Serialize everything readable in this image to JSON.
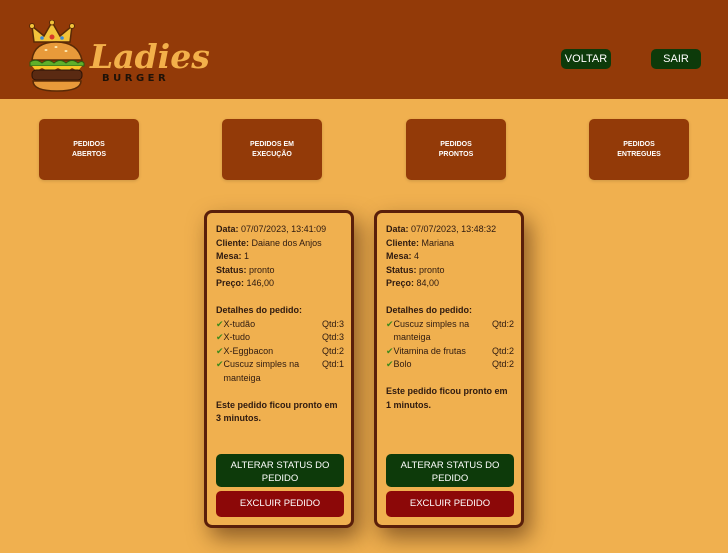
{
  "brand": {
    "name": "Ladies",
    "sub": "BURGER"
  },
  "header": {
    "voltar_label": "VOLTAR",
    "sair_label": "SAIR"
  },
  "nav": [
    {
      "label": "PEDIDOS ABERTOS"
    },
    {
      "label": "PEDIDOS EM EXECUÇÃO"
    },
    {
      "label": "PEDIDOS PRONTOS"
    },
    {
      "label": "PEDIDOS ENTREGUES"
    }
  ],
  "labels": {
    "data": "Data:",
    "cliente": "Cliente:",
    "mesa": "Mesa:",
    "status": "Status:",
    "preco": "Preço:",
    "detalhes": "Detalhes do pedido:",
    "alterar": "ALTERAR STATUS DO PEDIDO",
    "excluir": "EXCLUIR PEDIDO"
  },
  "orders": [
    {
      "data": "07/07/2023, 13:41:09",
      "cliente": "Daiane dos Anjos",
      "mesa": "1",
      "status": "pronto",
      "preco": "146,00",
      "items": [
        {
          "name": "X-tudão",
          "qty": "Qtd:3"
        },
        {
          "name": "X-tudo",
          "qty": "Qtd:3"
        },
        {
          "name": "X-Eggbacon",
          "qty": "Qtd:2"
        },
        {
          "name": "Cuscuz simples na manteiga",
          "qty": "Qtd:1"
        }
      ],
      "note": "Este pedido ficou pronto em 3 minutos."
    },
    {
      "data": "07/07/2023, 13:48:32",
      "cliente": "Mariana",
      "mesa": "4",
      "status": "pronto",
      "preco": "84,00",
      "items": [
        {
          "name": "Cuscuz simples na manteiga",
          "qty": "Qtd:2"
        },
        {
          "name": "Vitamina de frutas",
          "qty": "Qtd:2"
        },
        {
          "name": "Bolo",
          "qty": "Qtd:2"
        }
      ],
      "note": "Este pedido ficou pronto em 1 minutos."
    }
  ],
  "icons": {
    "check": "check-icon",
    "logo": "burger-crown-logo"
  },
  "colors": {
    "header": "#933a08",
    "background": "#f0b04f",
    "green": "#0d3a0a",
    "red": "#8c0808",
    "card_border": "#5a1f0a"
  }
}
